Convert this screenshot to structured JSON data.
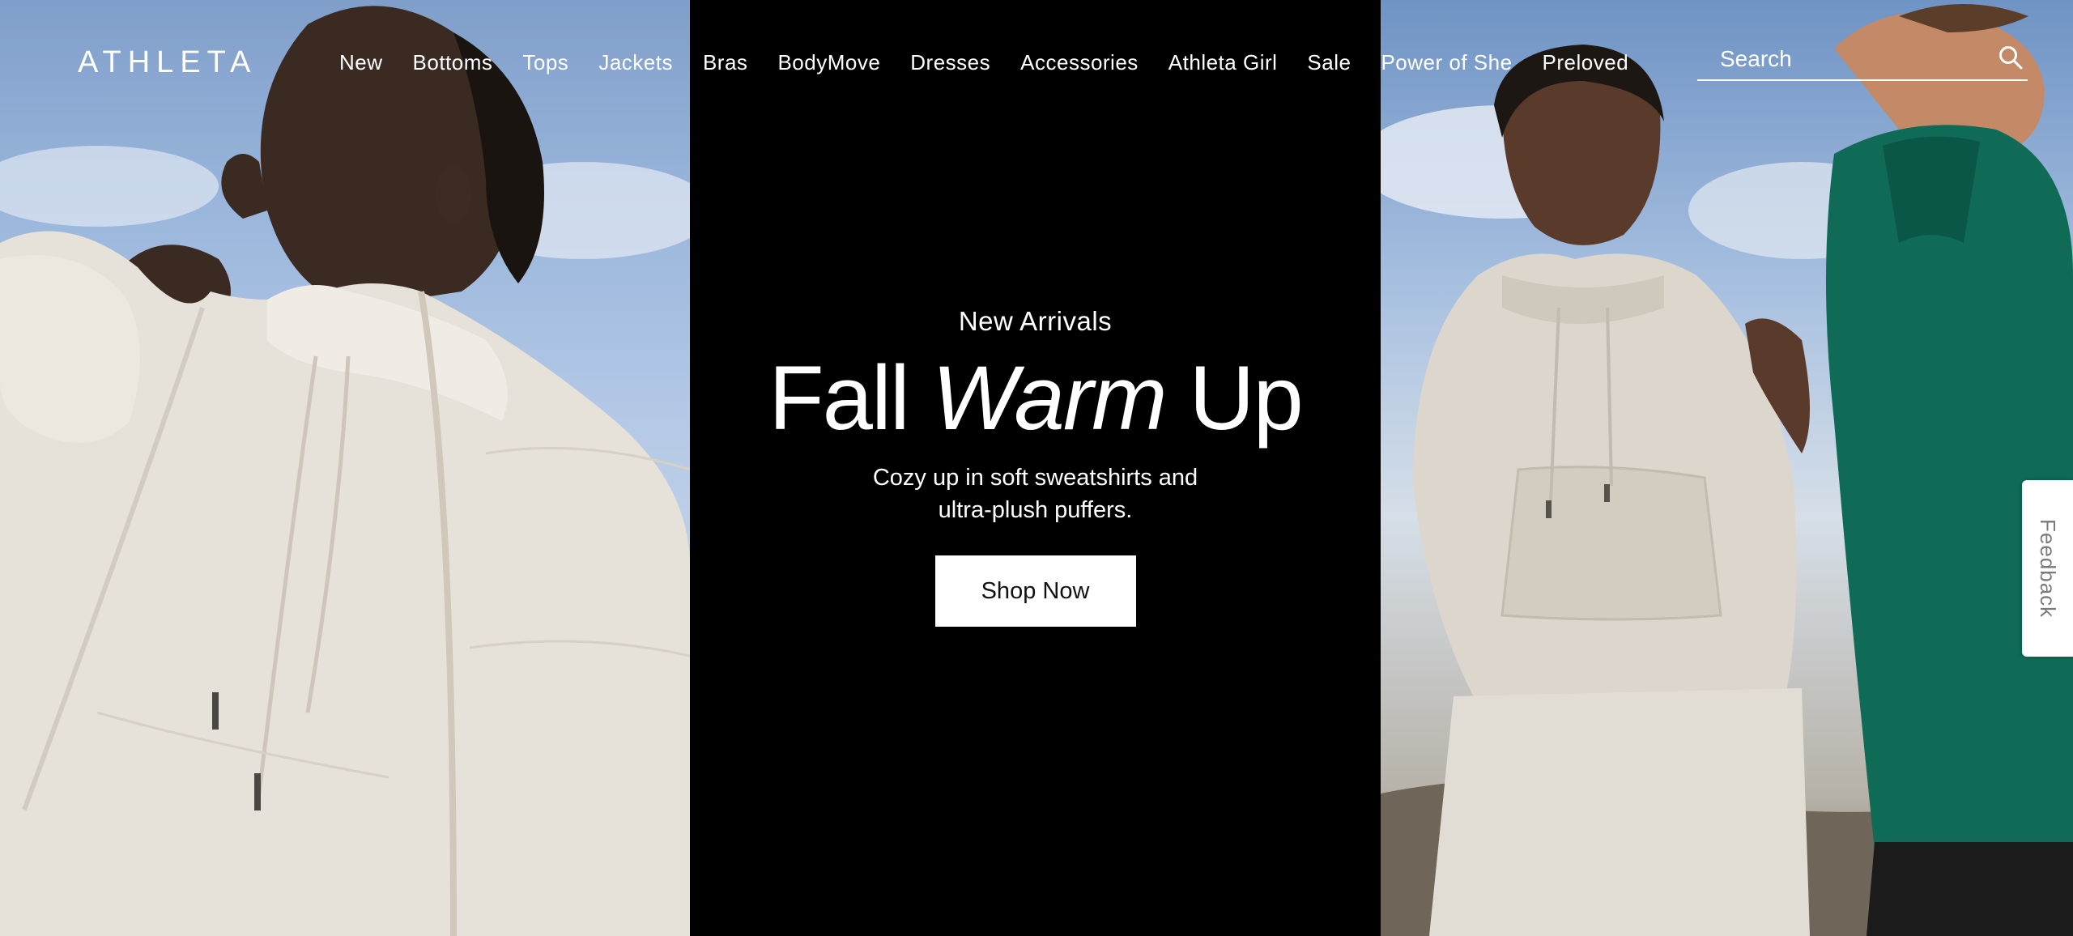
{
  "brand": {
    "logo_text": "ATHLETA"
  },
  "nav": {
    "items": [
      {
        "label": "New"
      },
      {
        "label": "Bottoms"
      },
      {
        "label": "Tops"
      },
      {
        "label": "Jackets"
      },
      {
        "label": "Bras"
      },
      {
        "label": "BodyMove"
      },
      {
        "label": "Dresses"
      },
      {
        "label": "Accessories"
      },
      {
        "label": "Athleta Girl"
      },
      {
        "label": "Sale"
      },
      {
        "label": "Power of She"
      },
      {
        "label": "Preloved"
      }
    ]
  },
  "search": {
    "placeholder": "Search",
    "icon": "search-icon"
  },
  "hero": {
    "eyebrow": "New Arrivals",
    "headline_start": "Fall ",
    "headline_emphasis": "Warm",
    "headline_end": " Up",
    "subcopy": "Cozy up in soft sweatshirts and ultra-plush puffers.",
    "cta_label": "Shop Now"
  },
  "feedback": {
    "label": "Feedback"
  },
  "colors": {
    "center_background": "#000000",
    "text": "#ffffff",
    "cta_background": "#ffffff",
    "cta_text": "#111111",
    "jacket_cream": "#e6e1d8",
    "pullover_green": "#0f6b55"
  }
}
